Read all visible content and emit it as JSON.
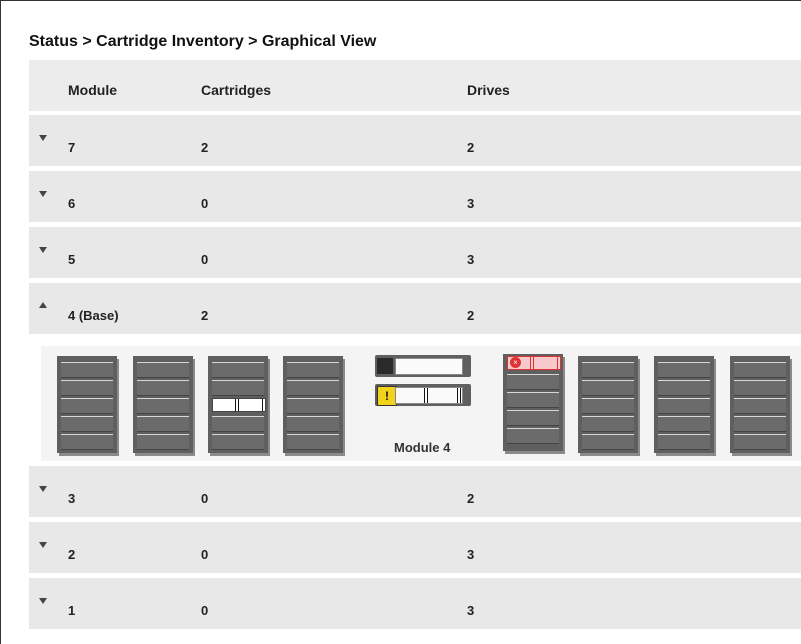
{
  "breadcrumb": "Status > Cartridge Inventory > Graphical View",
  "columns": {
    "module": "Module",
    "cartridges": "Cartridges",
    "drives": "Drives"
  },
  "rows": [
    {
      "module": "7",
      "cartridges": "2",
      "drives": "2",
      "expanded": false
    },
    {
      "module": "6",
      "cartridges": "0",
      "drives": "3",
      "expanded": false
    },
    {
      "module": "5",
      "cartridges": "0",
      "drives": "3",
      "expanded": false
    },
    {
      "module": "4 (Base)",
      "cartridges": "2",
      "drives": "2",
      "expanded": true
    },
    {
      "module": "3",
      "cartridges": "0",
      "drives": "2",
      "expanded": false
    },
    {
      "module": "2",
      "cartridges": "0",
      "drives": "3",
      "expanded": false
    },
    {
      "module": "1",
      "cartridges": "0",
      "drives": "3",
      "expanded": false
    }
  ],
  "module_graphic": {
    "label": "Module 4",
    "warning_symbol": "!",
    "error_symbol": "×",
    "colors": {
      "warning": "#f2d21a",
      "error": "#dd3333"
    }
  }
}
